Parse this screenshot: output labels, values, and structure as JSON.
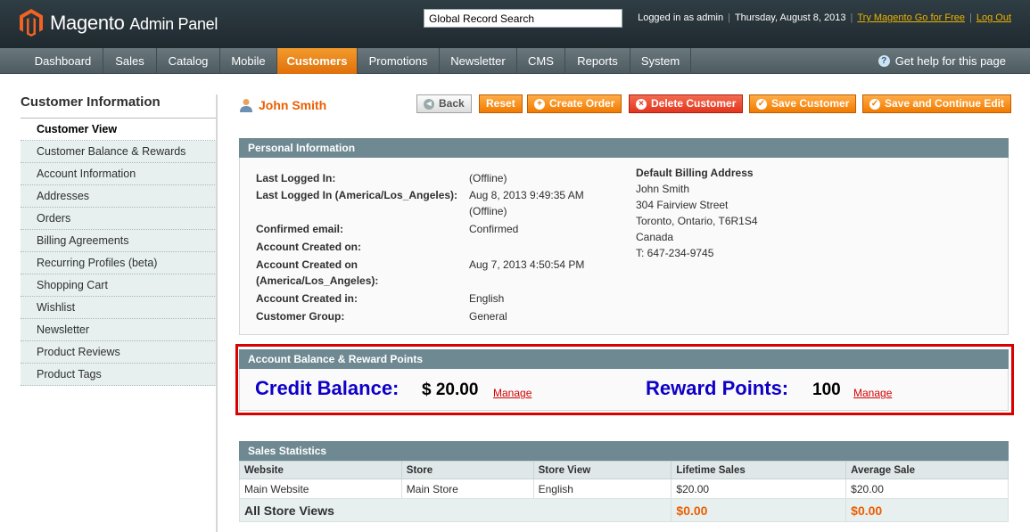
{
  "header": {
    "logo_main": "Magento",
    "logo_sub": "Admin Panel",
    "search_value": "Global Record Search",
    "logged_in": "Logged in as admin",
    "date": "Thursday, August 8, 2013",
    "try_link": "Try Magento Go for Free",
    "logout": "Log Out"
  },
  "nav": {
    "items": [
      "Dashboard",
      "Sales",
      "Catalog",
      "Mobile",
      "Customers",
      "Promotions",
      "Newsletter",
      "CMS",
      "Reports",
      "System"
    ],
    "active": "Customers",
    "help": "Get help for this page"
  },
  "sidebar": {
    "title": "Customer Information",
    "items": [
      "Customer View",
      "Customer Balance & Rewards",
      "Account Information",
      "Addresses",
      "Orders",
      "Billing Agreements",
      "Recurring Profiles (beta)",
      "Shopping Cart",
      "Wishlist",
      "Newsletter",
      "Product Reviews",
      "Product Tags"
    ]
  },
  "page": {
    "customer_name": "John Smith",
    "buttons": {
      "back": "Back",
      "reset": "Reset",
      "create_order": "Create Order",
      "delete_customer": "Delete Customer",
      "save_customer": "Save Customer",
      "save_continue": "Save and Continue Edit"
    }
  },
  "personal": {
    "title": "Personal Information",
    "last_logged_in_label": "Last Logged In:",
    "last_logged_in_value": "(Offline)",
    "last_logged_la_label": "Last Logged In (America/Los_Angeles):",
    "last_logged_la_value1": "Aug 8, 2013 9:49:35 AM",
    "last_logged_la_value2": "(Offline)",
    "confirmed_label": "Confirmed email:",
    "confirmed_value": "Confirmed",
    "created_on_label": "Account Created on:",
    "created_on_la_label1": "Account Created on",
    "created_on_la_label2": "(America/Los_Angeles):",
    "created_on_la_value": "Aug 7, 2013 4:50:54 PM",
    "created_in_label": "Account Created in:",
    "created_in_value": "English",
    "group_label": "Customer Group:",
    "group_value": "General",
    "billing_title": "Default Billing Address",
    "billing_name": "John Smith",
    "billing_street": "304 Fairview Street",
    "billing_city": "Toronto, Ontario, T6R1S4",
    "billing_country": "Canada",
    "billing_phone": "T: 647-234-9745"
  },
  "balance": {
    "title": "Account Balance & Reward Points",
    "credit_label": "Credit Balance:",
    "credit_value": "$ 20.00",
    "reward_label": "Reward Points:",
    "reward_value": "100",
    "manage": "Manage"
  },
  "sales": {
    "title": "Sales Statistics",
    "columns": [
      "Website",
      "Store",
      "Store View",
      "Lifetime Sales",
      "Average Sale"
    ],
    "rows": [
      [
        "Main Website",
        "Main Store",
        "English",
        "$20.00",
        "$20.00"
      ]
    ],
    "total_label": "All Store Views",
    "total_lifetime": "$0.00",
    "total_average": "$0.00"
  }
}
